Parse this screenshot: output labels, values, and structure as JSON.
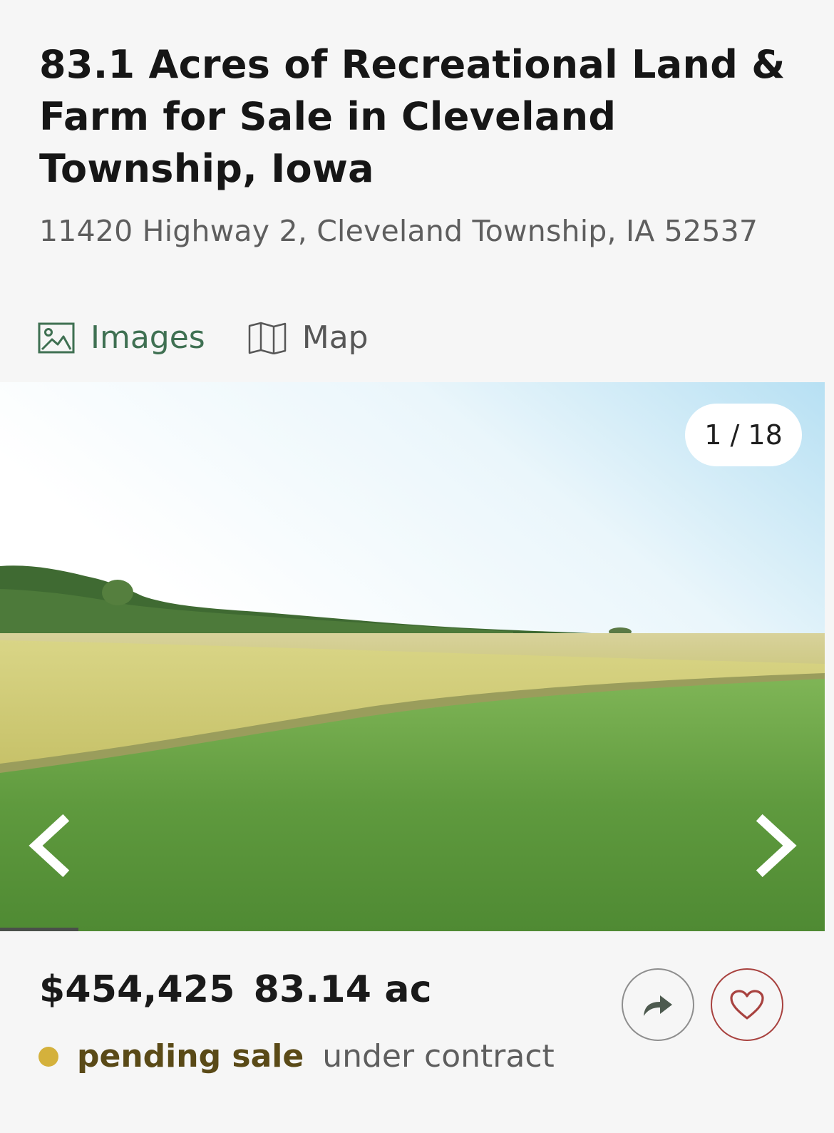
{
  "listing": {
    "title": "83.1 Acres of Recreational Land & Farm for Sale in Cleveland Township, Iowa",
    "address": "11420 Highway 2, Cleveland Township, IA 52537"
  },
  "tabs": {
    "images": {
      "label": "Images",
      "icon": "image-icon",
      "active": true
    },
    "map": {
      "label": "Map",
      "icon": "map-icon",
      "active": false
    }
  },
  "gallery": {
    "counter": "1 / 18",
    "current": 1,
    "total": 18,
    "prev_icon": "chevron-left-icon",
    "next_icon": "chevron-right-icon"
  },
  "summary": {
    "price": "$454,425",
    "acres": "83.14 ac"
  },
  "status": {
    "label": "pending sale",
    "detail": "under contract",
    "dot_color": "#d4b13c"
  },
  "actions": {
    "share_icon": "share-icon",
    "favorite_icon": "heart-icon"
  },
  "colors": {
    "accent_green": "#3f7052",
    "favorite_red": "#a8423f"
  }
}
